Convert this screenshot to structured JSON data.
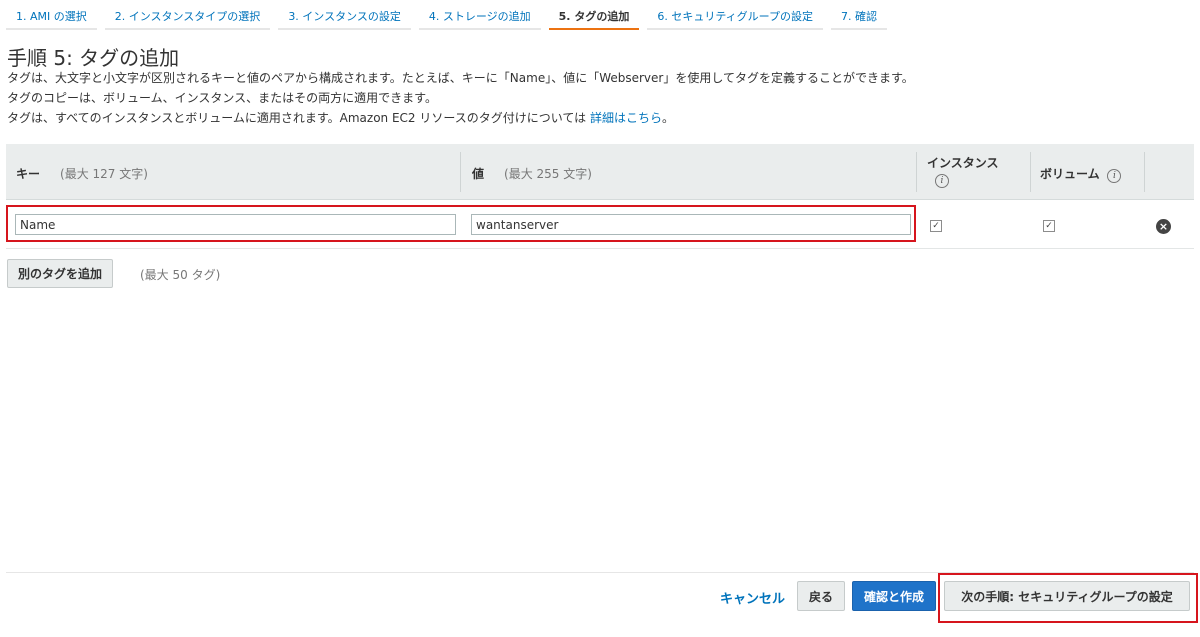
{
  "steps": [
    {
      "label": "1. AMI の選択"
    },
    {
      "label": "2. インスタンスタイプの選択"
    },
    {
      "label": "3. インスタンスの設定"
    },
    {
      "label": "4. ストレージの追加"
    },
    {
      "label": "5. タグの追加"
    },
    {
      "label": "6. セキュリティグループの設定"
    },
    {
      "label": "7. 確認"
    }
  ],
  "page": {
    "title": "手順 5: タグの追加",
    "desc1": "タグは、大文字と小文字が区別されるキーと値のペアから構成されます。たとえば、キーに「Name」、値に「Webserver」を使用してタグを定義することができます。",
    "desc2": "タグのコピーは、ボリューム、インスタンス、またはその両方に適用できます。",
    "desc3": "タグは、すべてのインスタンスとボリュームに適用されます。Amazon EC2 リソースのタグ付けについては",
    "desc3_link": "詳細はこちら",
    "desc3_end": "。"
  },
  "table": {
    "key_header": "キー",
    "key_hint": "(最大 127 文字)",
    "value_header": "値",
    "value_hint": "(最大 255 文字)",
    "instance_header": "インスタンス",
    "volume_header": "ボリューム",
    "info_glyph": "i",
    "rows": [
      {
        "key": "Name",
        "value": "wantanserver",
        "instance": true,
        "volume": true
      }
    ],
    "check_glyph": "✓",
    "remove_glyph": "×"
  },
  "add_tag": {
    "label": "別のタグを追加",
    "hint": "(最大 50 タグ)"
  },
  "footer": {
    "cancel": "キャンセル",
    "back": "戻る",
    "review": "確認と作成",
    "next": "次の手順: セキュリティグループの設定"
  },
  "colors": {
    "link": "#0073bb",
    "active_tab": "#ec7211",
    "highlight": "#d6151d",
    "primary_button": "#1f73c9"
  }
}
